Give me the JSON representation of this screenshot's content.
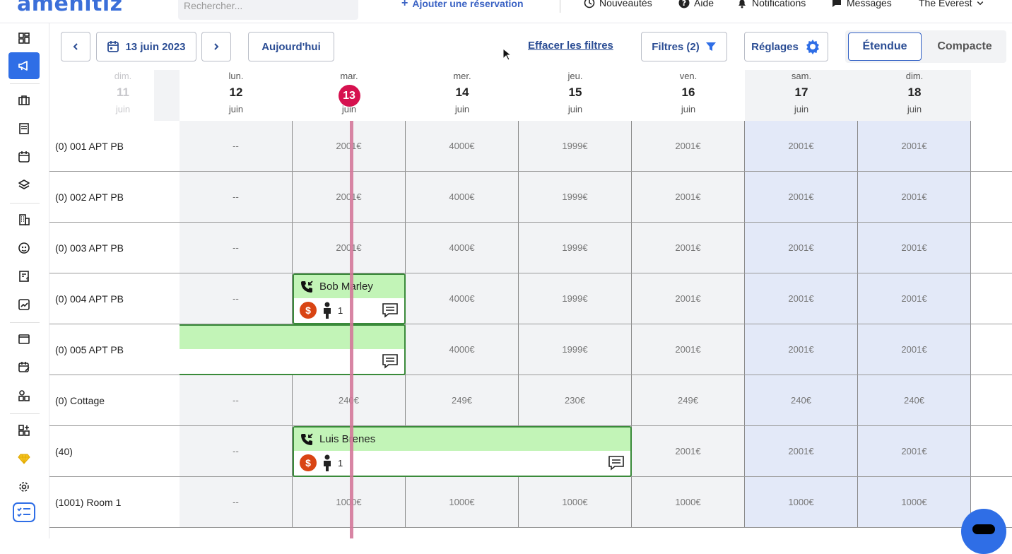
{
  "topbar": {
    "logo": "amenitiz",
    "search_placeholder": "Rechercher...",
    "add_reservation": "Ajouter une réservation",
    "news": "Nouveautés",
    "help": "Aide",
    "notifications": "Notifications",
    "messages": "Messages",
    "property": "The Everest"
  },
  "toolbar": {
    "date": "13 juin 2023",
    "today": "Aujourd'hui",
    "clear_filters": "Effacer les filtres",
    "filters": "Filtres (2)",
    "settings": "Réglages",
    "view_extended": "Étendue",
    "view_compact": "Compacte"
  },
  "days": [
    {
      "name": "dim.",
      "num": "11",
      "month": "juin"
    },
    {
      "name": "lun.",
      "num": "12",
      "month": "juin"
    },
    {
      "name": "mar.",
      "num": "13",
      "month": "juin"
    },
    {
      "name": "mer.",
      "num": "14",
      "month": "juin"
    },
    {
      "name": "jeu.",
      "num": "15",
      "month": "juin"
    },
    {
      "name": "ven.",
      "num": "16",
      "month": "juin"
    },
    {
      "name": "sam.",
      "num": "17",
      "month": "juin"
    },
    {
      "name": "dim.",
      "num": "18",
      "month": "juin"
    }
  ],
  "rooms": [
    {
      "name": "(0) 001 APT PB",
      "prices": [
        "--",
        "2001€",
        "4000€",
        "1999€",
        "2001€",
        "2001€",
        "2001€"
      ]
    },
    {
      "name": "(0) 002 APT PB",
      "prices": [
        "--",
        "2001€",
        "4000€",
        "1999€",
        "2001€",
        "2001€",
        "2001€"
      ]
    },
    {
      "name": "(0) 003 APT PB",
      "prices": [
        "--",
        "2001€",
        "4000€",
        "1999€",
        "2001€",
        "2001€",
        "2001€"
      ]
    },
    {
      "name": "(0) 004 APT PB",
      "prices": [
        "--",
        "",
        "4000€",
        "1999€",
        "2001€",
        "2001€",
        "2001€"
      ]
    },
    {
      "name": "(0) 005 APT PB",
      "prices": [
        "",
        "",
        "4000€",
        "1999€",
        "2001€",
        "2001€",
        "2001€"
      ]
    },
    {
      "name": "(0) Cottage",
      "prices": [
        "--",
        "240€",
        "249€",
        "230€",
        "249€",
        "240€",
        "240€"
      ]
    },
    {
      "name": "(40)",
      "prices": [
        "--",
        "",
        "",
        "",
        "2001€",
        "2001€",
        "2001€"
      ]
    },
    {
      "name": "(1001) Room 1",
      "prices": [
        "--",
        "1000€",
        "1000€",
        "1000€",
        "1000€",
        "1000€",
        "1000€"
      ]
    }
  ],
  "bookings": [
    {
      "guest": "Bob Marley",
      "persons": "1"
    },
    {
      "guest": "",
      "persons": ""
    },
    {
      "guest": "Luis Brenes",
      "persons": "1"
    }
  ],
  "colors": {
    "accent": "#2f6ee6",
    "today": "#d6114f",
    "booking_green": "#c2f4b7",
    "weekend": "#e3e9f8",
    "payment": "#d94413"
  }
}
